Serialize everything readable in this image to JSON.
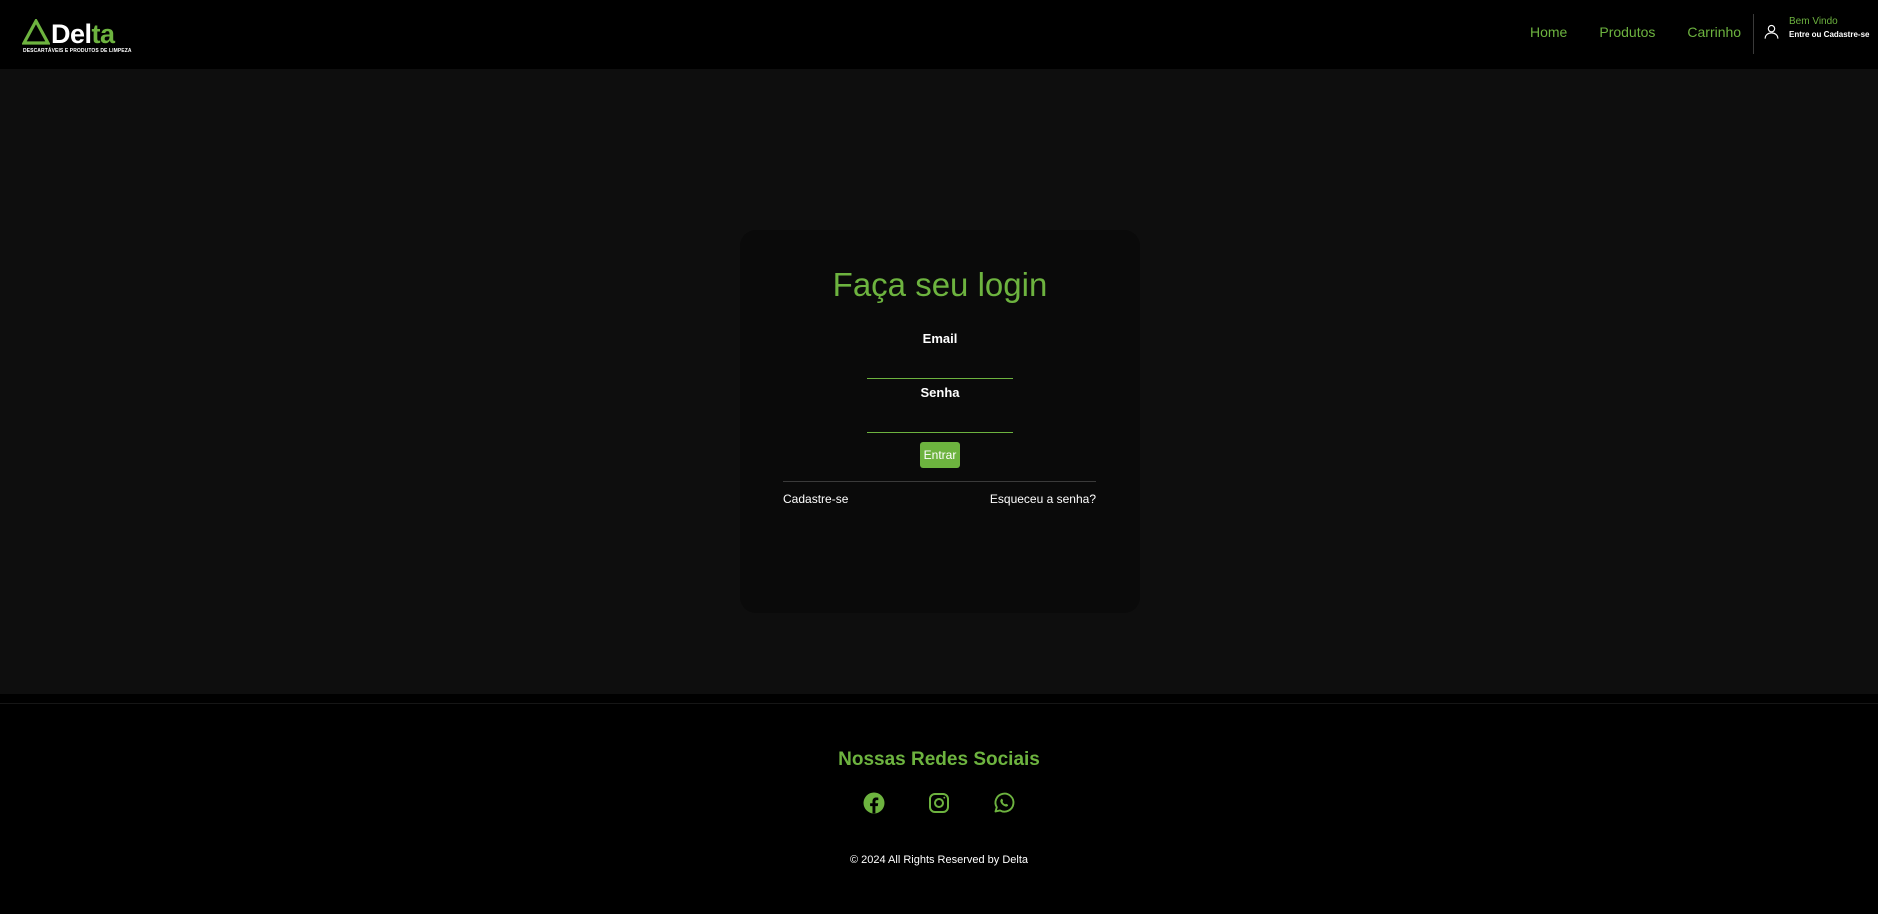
{
  "brand": {
    "name_part1": "Del",
    "name_part2": "ta",
    "tagline": "DESCARTÁVEIS E PRODUTOS DE LIMPEZA",
    "accent_color": "#6db33f"
  },
  "nav": {
    "items": [
      {
        "label": "Home"
      },
      {
        "label": "Produtos"
      },
      {
        "label": "Carrinho"
      }
    ]
  },
  "user": {
    "welcome": "Bem Vindo",
    "login_link": "Entre ou Cadastre-se",
    "icon": "user-icon"
  },
  "login": {
    "title": "Faça seu login",
    "email_label": "Email",
    "email_value": "",
    "password_label": "Senha",
    "password_value": "",
    "submit_label": "Entrar",
    "register_link": "Cadastre-se",
    "forgot_link": "Esqueceu a senha?"
  },
  "footer": {
    "title": "Nossas Redes Sociais",
    "socials": [
      {
        "icon": "facebook-icon"
      },
      {
        "icon": "instagram-icon"
      },
      {
        "icon": "whatsapp-icon"
      }
    ],
    "copyright": "© 2024 All Rights Reserved by Delta"
  }
}
